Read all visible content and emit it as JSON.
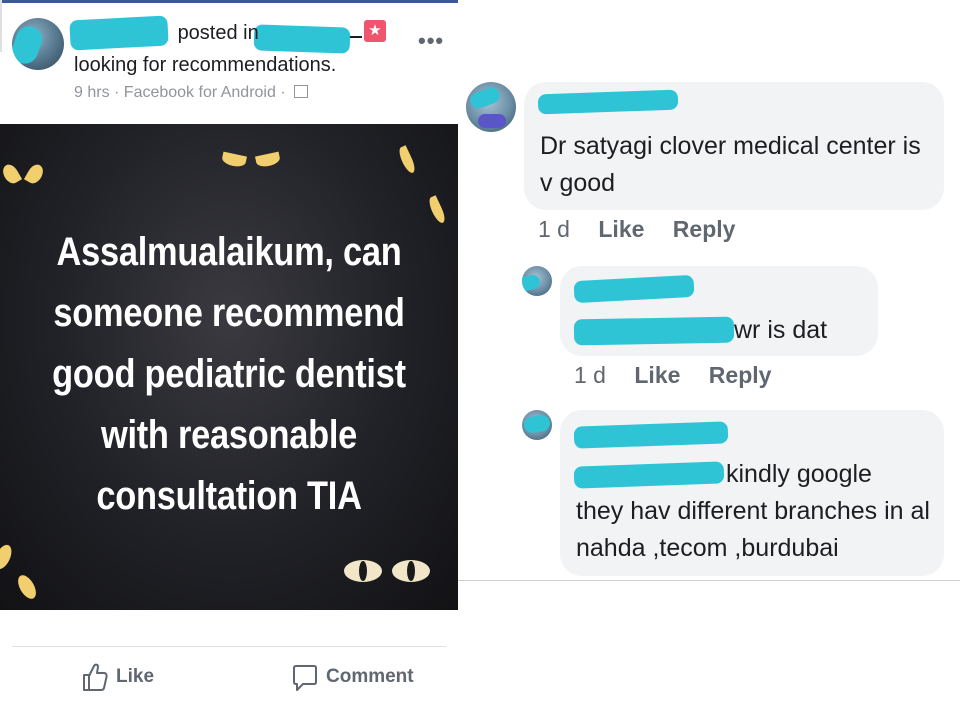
{
  "post": {
    "author": "",
    "posted_in_label": "posted in",
    "group": "",
    "text": "looking for recommendations.",
    "meta": "9 hrs · Facebook for Android ·",
    "more_icon": "more-dots-icon",
    "image_text": "Assalmualaikum, can someone recommend good pediatric dentist with reasonable consultation TIA",
    "actions": {
      "like": "Like",
      "comment": "Comment"
    },
    "colors": {
      "accent": "#3b5998",
      "redaction": "#2ec4d6",
      "badge": "#f0556f"
    }
  },
  "comments": [
    {
      "author": "",
      "text": "Dr satyagi clover medical center is v good",
      "time": "1 d",
      "like": "Like",
      "reply": "Reply"
    },
    {
      "author": "",
      "mention": "",
      "text": "wr is dat",
      "time": "1 d",
      "like": "Like",
      "reply": "Reply"
    },
    {
      "author": "",
      "mention": "",
      "text_line1": "kindly google",
      "text_rest": "they hav different branches in al nahda ,tecom ,burdubai"
    }
  ]
}
